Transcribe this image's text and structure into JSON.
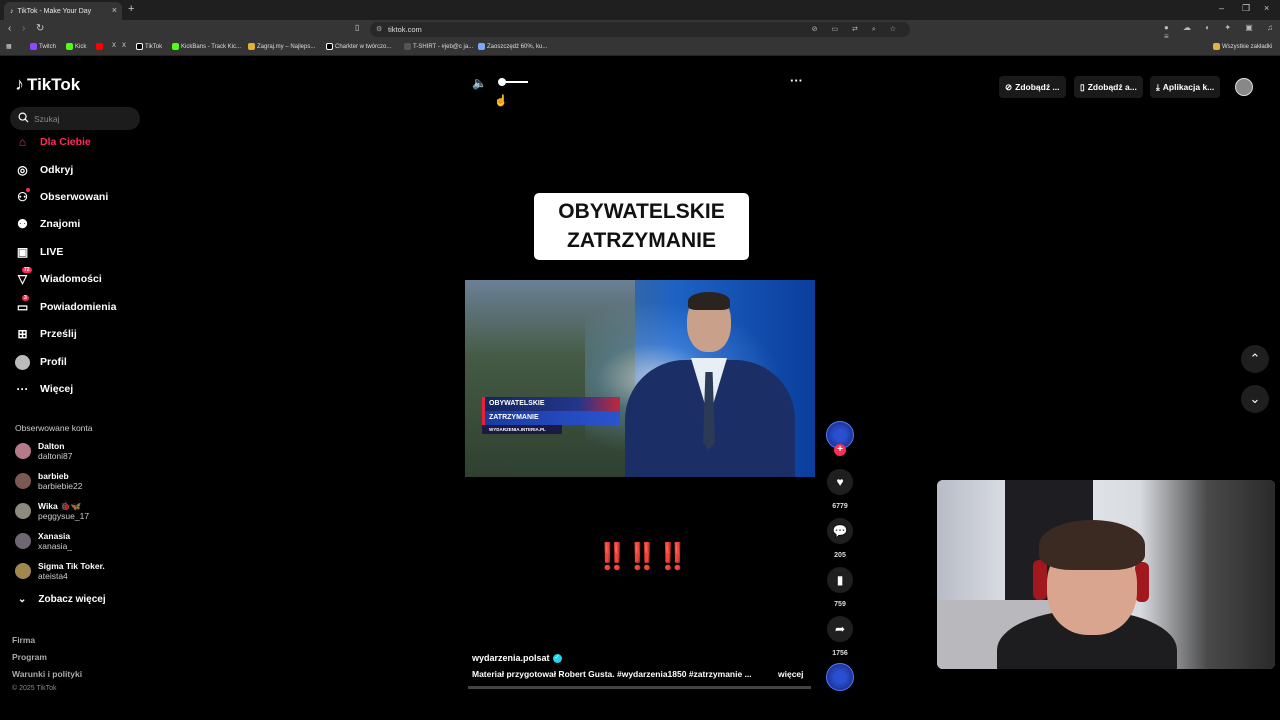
{
  "browser": {
    "tab_title": "TikTok - Make Your Day",
    "url": "tiktok.com",
    "bookmarks": [
      "Twitch",
      "Kick",
      "X",
      "TikTok",
      "KickBans - Track Kic...",
      "Zagraj.my – Najleps...",
      "Charkter w twórczo...",
      "T-SHIRT - #jeb@c ja...",
      "Zaoszczędź 60%, ku..."
    ],
    "all_bookmarks": "Wszystkie zakładki"
  },
  "sidebar": {
    "logo": "TikTok",
    "search_placeholder": "Szukaj",
    "nav": [
      {
        "label": "Dla Ciebie",
        "icon": "home-icon",
        "active": true
      },
      {
        "label": "Odkryj",
        "icon": "compass-icon"
      },
      {
        "label": "Obserwowani",
        "icon": "following-icon"
      },
      {
        "label": "Znajomi",
        "icon": "friends-icon"
      },
      {
        "label": "LIVE",
        "icon": "live-icon"
      },
      {
        "label": "Wiadomości",
        "icon": "messages-icon",
        "badge": "72"
      },
      {
        "label": "Powiadomienia",
        "icon": "notifications-icon",
        "badge": "3"
      },
      {
        "label": "Prześlij",
        "icon": "upload-icon"
      },
      {
        "label": "Profil",
        "icon": "profile-icon"
      },
      {
        "label": "Więcej",
        "icon": "more-icon"
      }
    ],
    "followed_header": "Obserwowane konta",
    "accounts": [
      {
        "name": "Dalton",
        "handle": "daltoni87"
      },
      {
        "name": "barbieb",
        "handle": "barbiebie22"
      },
      {
        "name": "Wika 🐞🦋",
        "handle": "peggysue_17"
      },
      {
        "name": "Xanasia",
        "handle": "xanasia_"
      },
      {
        "name": "Sigma Tik Toker.",
        "handle": "ateista4"
      }
    ],
    "see_more": "Zobacz więcej",
    "footer": [
      "Firma",
      "Program",
      "Warunki i polityki"
    ],
    "copyright": "© 2025 TikTok"
  },
  "topbar": {
    "buttons": [
      "Zdobądź ...",
      "Zdobądź a...",
      "Aplikacja k..."
    ]
  },
  "video": {
    "title_card_line1": "OBYWATELSKIE",
    "title_card_line2": "ZATRZYMANIE",
    "lower_third_1": "OBYWATELSKIE",
    "lower_third_2": "ZATRZYMANIE",
    "lower_third_3": "WYDARZENIA.INTERIA.PL",
    "emphasis": "‼️‼️‼️",
    "author": "wydarzenia.polsat",
    "caption": "Materiał przygotował Robert Gusta. #wydarzenia1850  #zatrzymanie  ...",
    "more_label": "więcej",
    "progress": 0.0
  },
  "actions": {
    "likes": "6779",
    "comments": "205",
    "saves": "759",
    "shares": "1756"
  },
  "colors": {
    "accent": "#fe2c55",
    "bg": "#000000"
  }
}
